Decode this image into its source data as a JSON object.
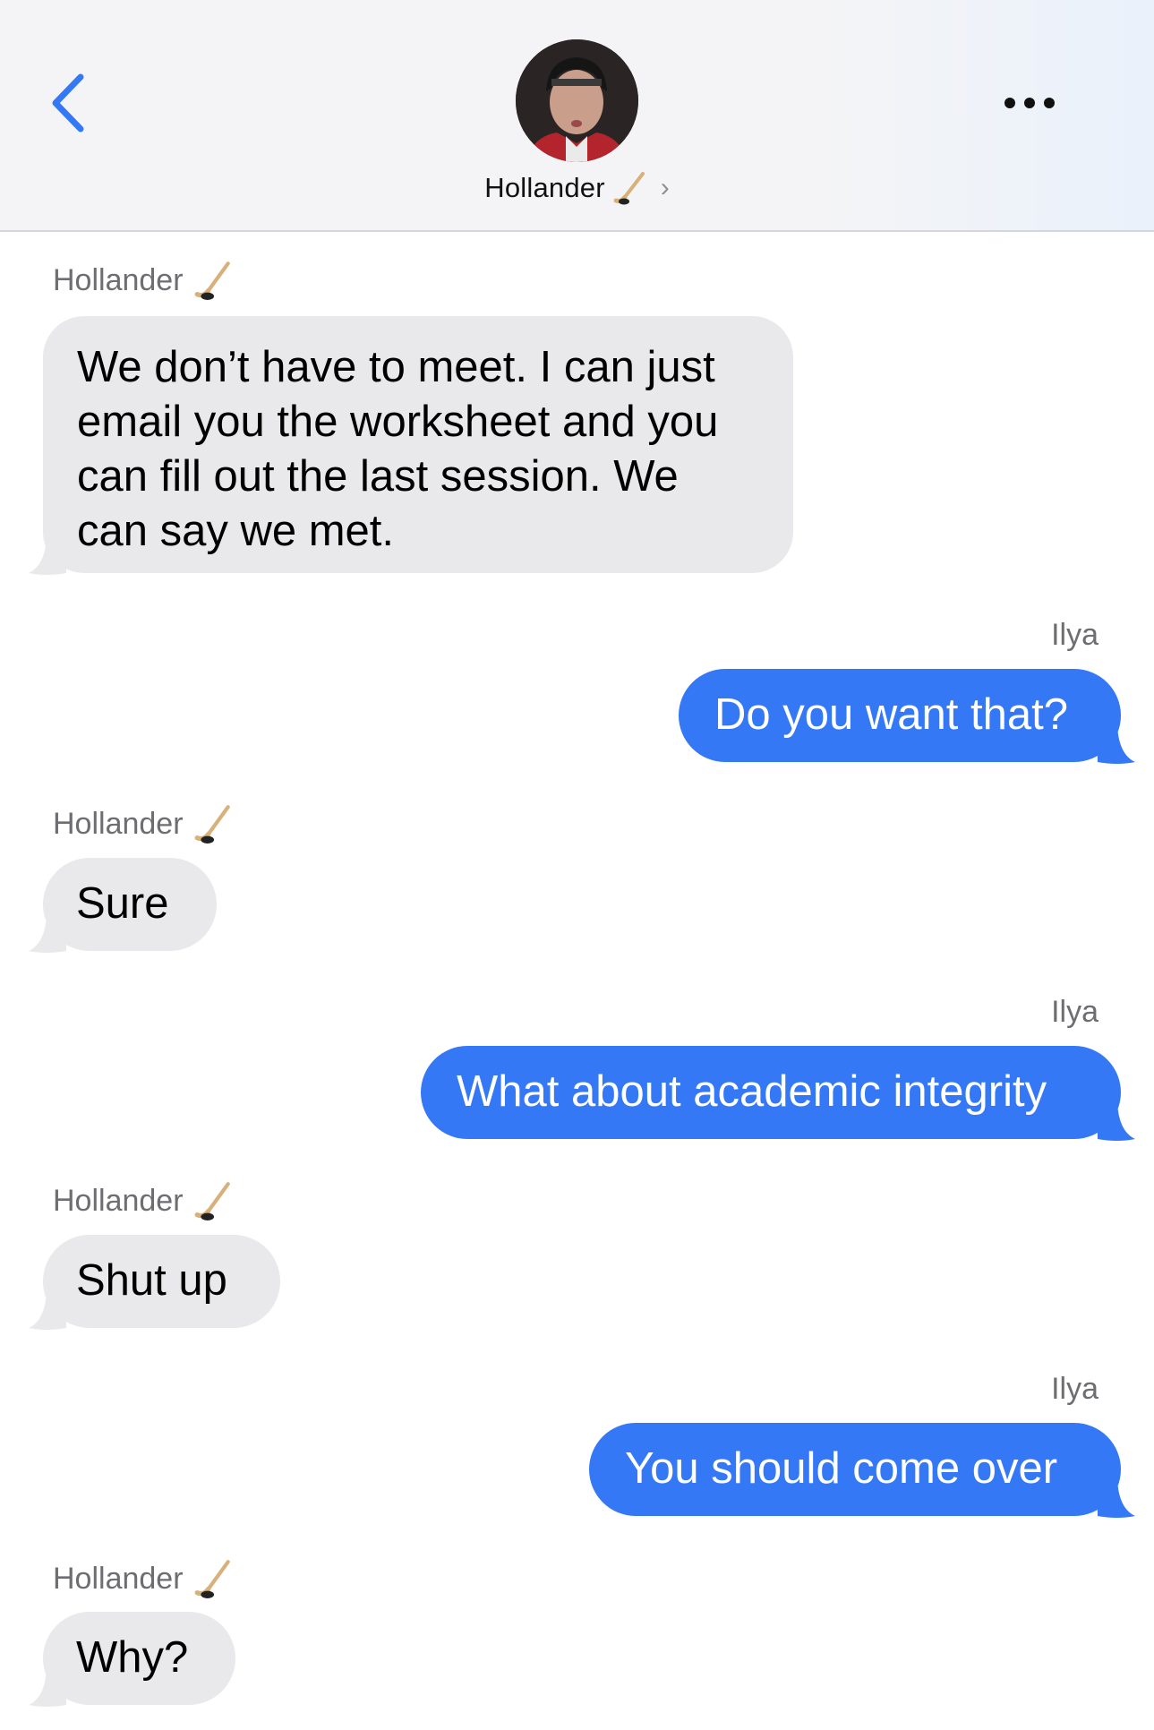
{
  "header": {
    "back_icon": "chevron-left-icon",
    "contact_name": "Hollander",
    "contact_emoji": "hockey-stick-icon",
    "chevron": "›",
    "more_icon": "ellipsis-icon",
    "accent_color": "#3478f6"
  },
  "messages": [
    {
      "sender": "Hollander",
      "direction": "incoming",
      "text": "We don’t have to meet. I can just email you the worksheet and you can fill out the last session. We can say we met."
    },
    {
      "sender": "Ilya",
      "direction": "outgoing",
      "text": "Do you want that?"
    },
    {
      "sender": "Hollander",
      "direction": "incoming",
      "text": "Sure"
    },
    {
      "sender": "Ilya",
      "direction": "outgoing",
      "text": "What about academic integrity"
    },
    {
      "sender": "Hollander",
      "direction": "incoming",
      "text": "Shut up"
    },
    {
      "sender": "Ilya",
      "direction": "outgoing",
      "text": "You should come over"
    },
    {
      "sender": "Hollander",
      "direction": "incoming",
      "text": "Why?"
    }
  ]
}
